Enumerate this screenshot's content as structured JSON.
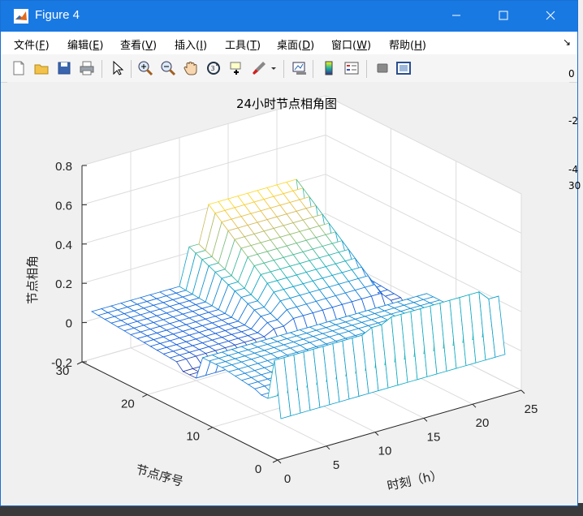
{
  "window": {
    "title": "Figure 4"
  },
  "menu": [
    {
      "label": "文件",
      "key": "F"
    },
    {
      "label": "编辑",
      "key": "E"
    },
    {
      "label": "查看",
      "key": "V"
    },
    {
      "label": "插入",
      "key": "I"
    },
    {
      "label": "工具",
      "key": "T"
    },
    {
      "label": "桌面",
      "key": "D"
    },
    {
      "label": "窗口",
      "key": "W"
    },
    {
      "label": "帮助",
      "key": "H"
    }
  ],
  "toolbar_icons": [
    "new-file-icon",
    "open-folder-icon",
    "save-icon",
    "print-icon",
    "pointer-icon",
    "zoom-in-icon",
    "zoom-out-icon",
    "pan-hand-icon",
    "rotate-3d-icon",
    "data-cursor-icon",
    "brush-icon",
    "link-plot-icon",
    "colorbar-icon",
    "legend-icon",
    "hide-plot-tools-icon",
    "show-plot-tools-icon"
  ],
  "right_fragments": [
    "0",
    "-2",
    "-4",
    "30"
  ],
  "chart_data": {
    "type": "surface",
    "title": "24小时节点相角图",
    "xlabel": "时刻（h）",
    "ylabel": "节点序号",
    "zlabel": "节点相角",
    "x_ticks": [
      "0",
      "5",
      "10",
      "15",
      "20",
      "25"
    ],
    "y_ticks": [
      "0",
      "10",
      "20",
      "30"
    ],
    "z_ticks": [
      "-0.2",
      "0",
      "0.2",
      "0.4",
      "0.6",
      "0.8"
    ],
    "xlim": [
      0,
      25
    ],
    "ylim": [
      0,
      30
    ],
    "zlim": [
      -0.2,
      0.8
    ],
    "hours": 24,
    "nodes": 30,
    "colormap": "parula",
    "grid": true
  }
}
